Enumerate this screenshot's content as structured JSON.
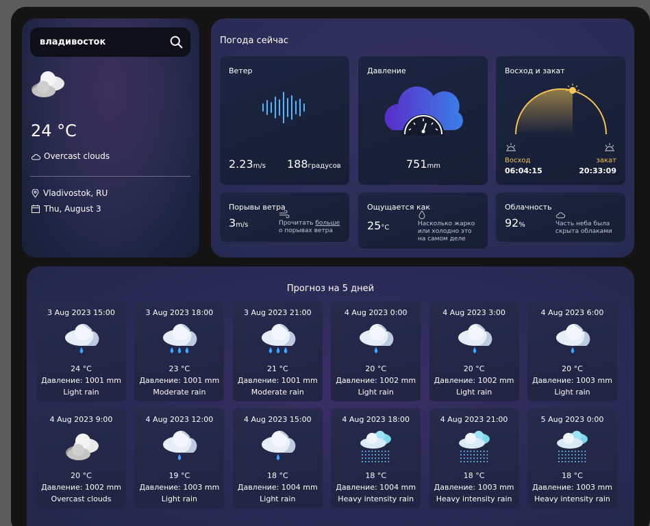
{
  "search": {
    "value": "владивосток"
  },
  "current": {
    "temp": "24 °C",
    "condition": "Overcast clouds",
    "location": "Vladivostok, RU",
    "date": "Thu, August 3"
  },
  "now": {
    "title": "Погода сейчас",
    "wind": {
      "title": "Ветер",
      "speed": "2.23",
      "speed_unit": "m/s",
      "dir": "188",
      "dir_unit": "градусов"
    },
    "pressure": {
      "title": "Давление",
      "value": "751",
      "unit": "mm"
    },
    "sun": {
      "title": "Восход и закат",
      "sunrise_label": "Восход",
      "sunrise": "06:04:15",
      "sunset_label": "закат",
      "sunset": "20:33:09"
    },
    "gust": {
      "title": "Порывы ветра",
      "value": "3",
      "unit": "m/s",
      "note_pre": "Прочитать ",
      "note_link": "больше",
      "note_post": "о порывах ветра"
    },
    "feels": {
      "title": "Ощущается как",
      "value": "25",
      "unit": "°C",
      "note": "Насколько жарко или холодно это на самом деле"
    },
    "clouds": {
      "title": "Облачность",
      "value": "92",
      "unit": "%",
      "note": "Часть неба была скрыта облаками"
    }
  },
  "forecast": {
    "title": "Прогноз на 5 дней",
    "items": [
      {
        "time": "3 Aug 2023 15:00",
        "temp": "24 °C",
        "press": "Давление: 1001 mm",
        "desc": "Light rain",
        "icon": "light-rain"
      },
      {
        "time": "3 Aug 2023 18:00",
        "temp": "23 °C",
        "press": "Давление: 1001 mm",
        "desc": "Moderate rain",
        "icon": "moderate-rain"
      },
      {
        "time": "3 Aug 2023 21:00",
        "temp": "21 °C",
        "press": "Давление: 1001 mm",
        "desc": "Moderate rain",
        "icon": "moderate-rain"
      },
      {
        "time": "4 Aug 2023 0:00",
        "temp": "20 °C",
        "press": "Давление: 1002 mm",
        "desc": "Light rain",
        "icon": "light-rain"
      },
      {
        "time": "4 Aug 2023 3:00",
        "temp": "20 °C",
        "press": "Давление: 1002 mm",
        "desc": "Light rain",
        "icon": "light-rain"
      },
      {
        "time": "4 Aug 2023 6:00",
        "temp": "20 °C",
        "press": "Давление: 1003 mm",
        "desc": "Light rain",
        "icon": "light-rain"
      },
      {
        "time": "4 Aug 2023 9:00",
        "temp": "20 °C",
        "press": "Давление: 1002 mm",
        "desc": "Overcast clouds",
        "icon": "overcast"
      },
      {
        "time": "4 Aug 2023 12:00",
        "temp": "19 °C",
        "press": "Давление: 1003 mm",
        "desc": "Light rain",
        "icon": "light-rain"
      },
      {
        "time": "4 Aug 2023 15:00",
        "temp": "18 °C",
        "press": "Давление: 1004 mm",
        "desc": "Light rain",
        "icon": "light-rain"
      },
      {
        "time": "4 Aug 2023 18:00",
        "temp": "18 °C",
        "press": "Давление: 1004 mm",
        "desc": "Heavy intensity rain",
        "icon": "heavy-rain"
      },
      {
        "time": "4 Aug 2023 21:00",
        "temp": "18 °C",
        "press": "Давление: 1003 mm",
        "desc": "Heavy intensity rain",
        "icon": "heavy-rain"
      },
      {
        "time": "5 Aug 2023 0:00",
        "temp": "18 °C",
        "press": "Давление: 1003 mm",
        "desc": "Heavy intensity rain",
        "icon": "heavy-rain"
      }
    ]
  }
}
